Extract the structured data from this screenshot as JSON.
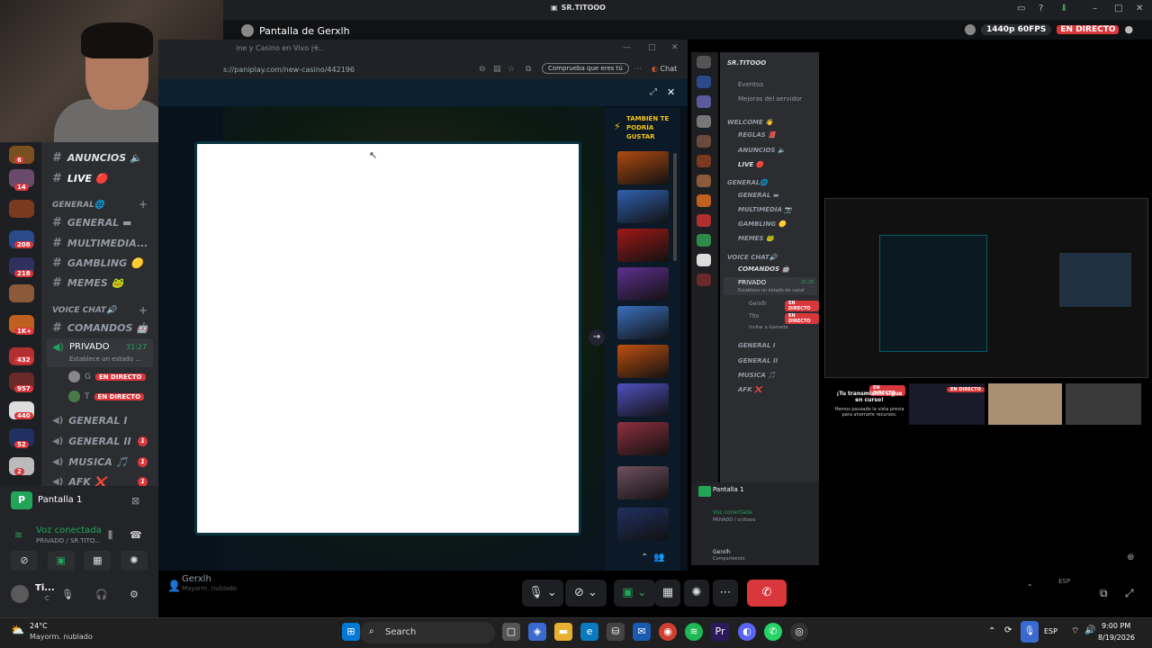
{
  "window": {
    "title": "SR.TITOOO"
  },
  "stream": {
    "title": "Pantalla de Gerxlh",
    "quality": "1440p 60FPS",
    "live": "EN DIRECTO"
  },
  "browser": {
    "tab": "ine y Casino en Vivo | ...",
    "url": "s://paniplay.com/new-casino/442196",
    "verify": "Comprueba que eres tú",
    "chat": "Chat"
  },
  "game": {
    "suggest_title": "TAMBIÉN TE PODRÍA GUSTAR",
    "thumbs": [
      "#b04a10",
      "#3060b0",
      "#a01818",
      "#603090",
      "#3a70c0",
      "#c05010",
      "#5050c0",
      "#903040",
      "#705060",
      "#203060"
    ]
  },
  "servers": {
    "badges": [
      "6",
      "14",
      "208",
      "218",
      "1K+",
      "432",
      "957",
      "440",
      "52",
      "2"
    ]
  },
  "channels": {
    "items": [
      {
        "icon": "#",
        "label": "ANUNCIOS 🔈"
      },
      {
        "icon": "#",
        "label": "LIVE 🔴"
      }
    ],
    "cat_general": "GENERAL🌐",
    "general": [
      {
        "label": "GENERAL ▬"
      },
      {
        "label": "MULTIMEDIA..."
      },
      {
        "label": "GAMBLING 🟡"
      },
      {
        "label": "MEMES 🐸"
      }
    ],
    "cat_voice": "VOICE CHAT🔊",
    "comandos": "COMANDOS 🤖",
    "privado": "PRIVADO",
    "privado_time": "31:27",
    "privado_status": "Establece un estado ...",
    "user_g": "G",
    "user_t": "T",
    "live_badge": "EN DIRECTO",
    "voice": [
      {
        "label": "GENERAL I",
        "count": ""
      },
      {
        "label": "GENERAL II",
        "count": "1"
      },
      {
        "label": "MUSICA 🎵",
        "count": "1"
      },
      {
        "label": "AFK ❌",
        "count": "1"
      }
    ]
  },
  "voicepanel": {
    "share": "Pantalla 1",
    "connected": "Voz conectada",
    "channel": "PRIVADO / SR.TITO...",
    "user": "Ti...",
    "user_sub": "C"
  },
  "right": {
    "server": "SR.TITOOO",
    "events": "Eventos",
    "improve": "Mejoras del servidor",
    "welcome": "WELCOME 👋",
    "channels": [
      "REGLAS 📕",
      "ANUNCIOS 🔈",
      "LIVE 🔴"
    ],
    "general_cat": "GENERAL🌐",
    "general": [
      "GENERAL ▬",
      "MULTIMEDIA 📷",
      "GAMBLING 🟡",
      "MEMES 🐸"
    ],
    "voice_cat": "VOICE CHAT🔊",
    "comandos": "COMANDOS 🤖",
    "privado": "PRIVADO",
    "privado_time": "31:26",
    "privado_status": "Establece un estado de canal",
    "users": [
      "Gerxlh",
      "Tito"
    ],
    "invite": "Invitar a Gamada",
    "voices": [
      "GENERAL I",
      "GENERAL II",
      "MUSICA 🎵",
      "AFK ❌"
    ],
    "share": "Pantalla 1",
    "voz": "Voz conectada",
    "vozsub": "PRIVADO / sr.titooo",
    "user": "Gerxlh",
    "usersub": "Compartiendo",
    "paused_title": "¡Tu transmisión sigue en curso!",
    "paused_sub": "Hemos pausado la vista previa para ahorrarte recursos.",
    "tile_live": "EN DIRECTO"
  },
  "bottom": {
    "user": "Gerxlh",
    "status": "Mayorm. nublado"
  },
  "taskbar": {
    "temp": "24°C",
    "weather": "Mayorm. nublado",
    "search": "Search",
    "lang": "ESP",
    "time": "9:00 PM",
    "date": "8/19/2026"
  }
}
